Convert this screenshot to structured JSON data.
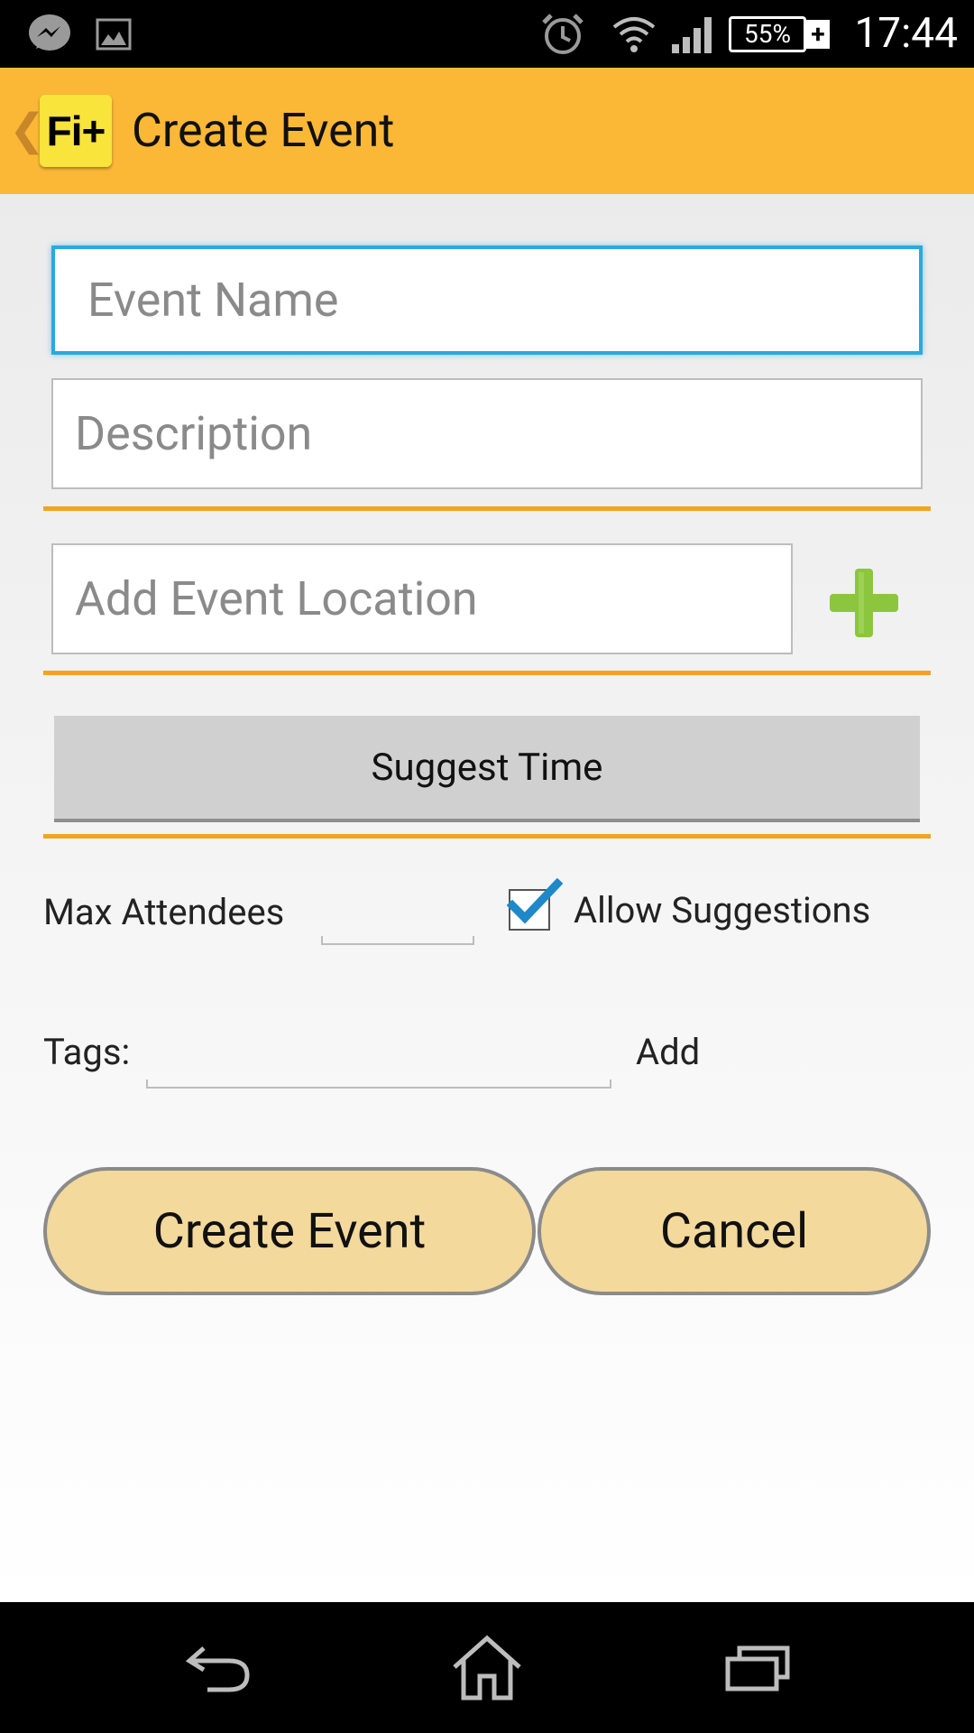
{
  "status_bar": {
    "time": "17:44",
    "battery_percent": "55%",
    "battery_charging_symbol": "+",
    "icons": [
      "messenger-icon",
      "gallery-icon",
      "alarm-icon",
      "wifi-icon",
      "signal-icon",
      "battery-icon"
    ]
  },
  "action_bar": {
    "logo_text": "Fi+",
    "title": "Create Event"
  },
  "form": {
    "event_name_placeholder": "Event Name",
    "description_placeholder": "Description",
    "location_placeholder": "Add Event Location",
    "suggest_time_label": "Suggest Time",
    "max_attendees_label": "Max Attendees",
    "max_attendees_value": "",
    "allow_suggestions_label": "Allow Suggestions",
    "allow_suggestions_checked": true,
    "tags_label": "Tags:",
    "tags_value": "",
    "add_tag_label": "Add",
    "create_button_label": "Create Event",
    "cancel_button_label": "Cancel"
  },
  "colors": {
    "action_bar": "#fbb836",
    "divider": "#f5a224",
    "focus_border": "#29a9e1",
    "plus_icon": "#8cc63f",
    "pill_button": "#f3d99c",
    "checkmark": "#1e88c8"
  },
  "nav_bar": {
    "icons": [
      "back-icon",
      "home-icon",
      "recent-apps-icon"
    ]
  }
}
